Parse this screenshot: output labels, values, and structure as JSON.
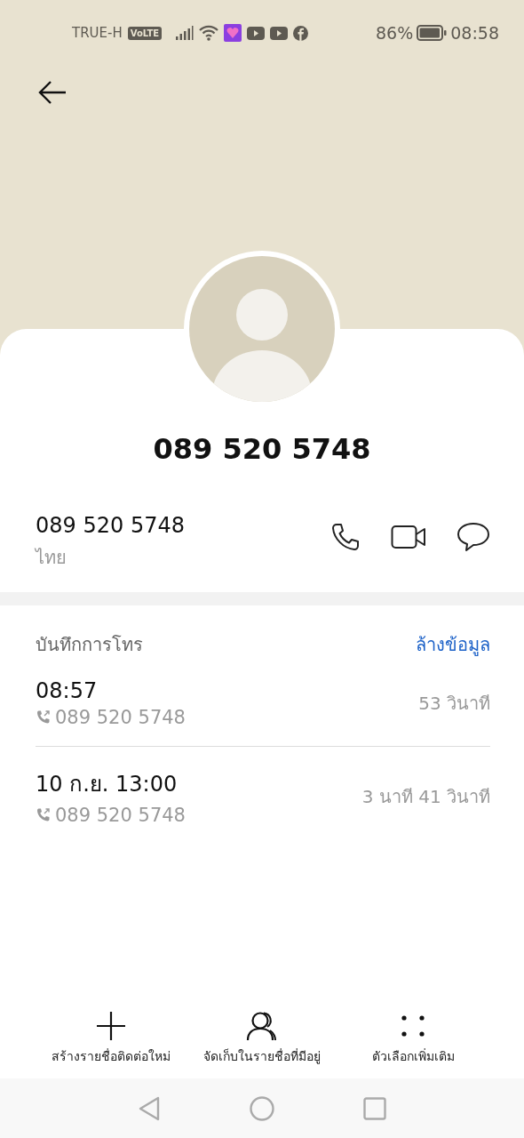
{
  "status_bar": {
    "carrier": "TRUE-H",
    "network_badge": "VoLTE",
    "battery_percent": "86%",
    "time": "08:58"
  },
  "contact": {
    "title": "089 520 5748"
  },
  "number": {
    "value": "089 520 5748",
    "region": "ไทย"
  },
  "call_log": {
    "title": "บันทึกการโทร",
    "clear_label": "ล้างข้อมูล",
    "entries": [
      {
        "time": "08:57",
        "number": "089 520 5748",
        "duration": "53 วินาที"
      },
      {
        "time": "10 ก.ย. 13:00",
        "number": "089 520 5748",
        "duration": "3 นาที 41 วินาที"
      }
    ]
  },
  "actions": [
    {
      "kind": "add",
      "label": "สร้างรายชื่อติดต่อใหม่"
    },
    {
      "kind": "contacts",
      "label": "จัดเก็บในรายชื่อที่มีอยู่"
    },
    {
      "kind": "more",
      "label": "ตัวเลือกเพิ่มเติม"
    }
  ]
}
